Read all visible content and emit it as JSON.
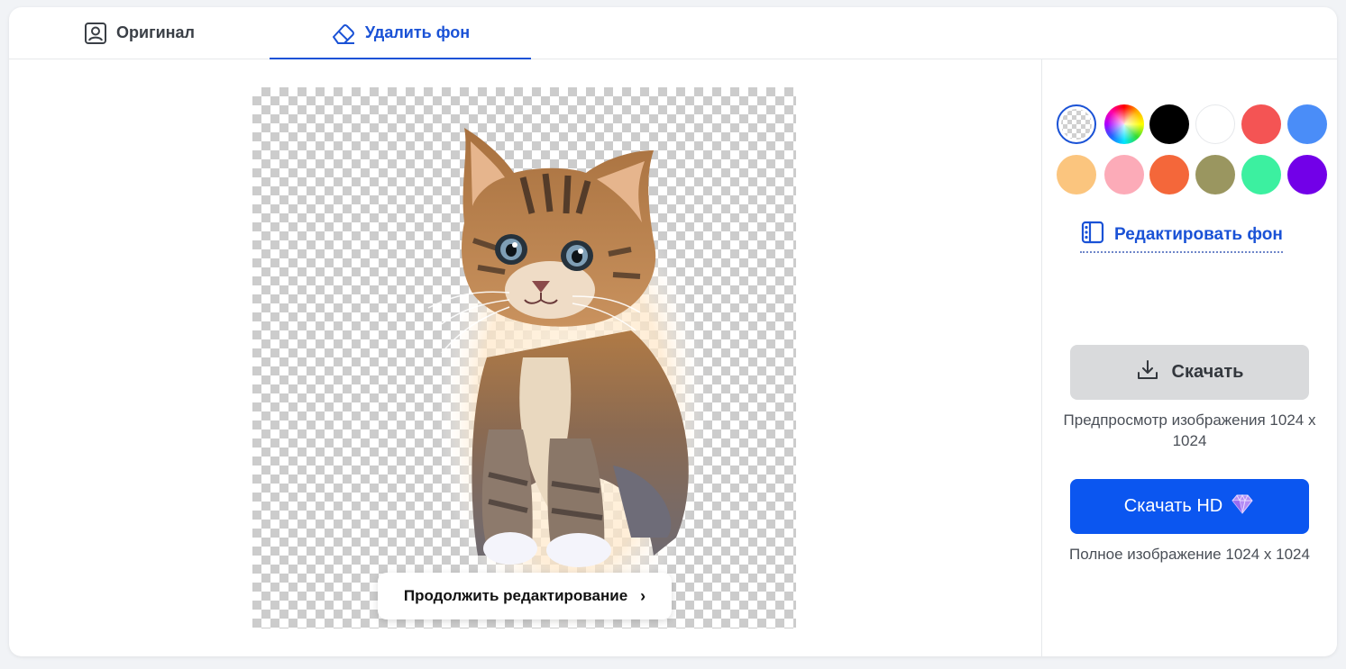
{
  "tabs": [
    {
      "label": "Оригинал",
      "icon": "user-portrait-icon",
      "active": false
    },
    {
      "label": "Удалить фон",
      "icon": "eraser-icon",
      "active": true
    }
  ],
  "editor": {
    "continue_label": "Продолжить редактирование",
    "continue_icon": "chevron-right-icon",
    "image_subject": "kitten"
  },
  "background_colors": [
    {
      "name": "transparent",
      "color": "transparent",
      "selected": true
    },
    {
      "name": "rainbow",
      "color": "multicolor"
    },
    {
      "name": "black",
      "color": "#000000"
    },
    {
      "name": "white",
      "color": "#ffffff"
    },
    {
      "name": "red",
      "color": "#f45454"
    },
    {
      "name": "blue",
      "color": "#4a8df8"
    },
    {
      "name": "peach",
      "color": "#fbc57e"
    },
    {
      "name": "pink",
      "color": "#fcabb8"
    },
    {
      "name": "orange",
      "color": "#f4673a"
    },
    {
      "name": "olive",
      "color": "#9a9660"
    },
    {
      "name": "green",
      "color": "#3cf0a0"
    },
    {
      "name": "purple",
      "color": "#7200e8"
    }
  ],
  "sidebar": {
    "edit_bg_label": "Редактировать фон",
    "download_label": "Скачать",
    "preview_text": "Предпросмотр изображения 1024 x 1024",
    "download_hd_label": "Скачать HD",
    "full_text": "Полное изображение 1024 x 1024"
  },
  "colors": {
    "accent": "#1a52d6",
    "hd_button": "#0b56f0",
    "download_button": "#d9dadc"
  }
}
